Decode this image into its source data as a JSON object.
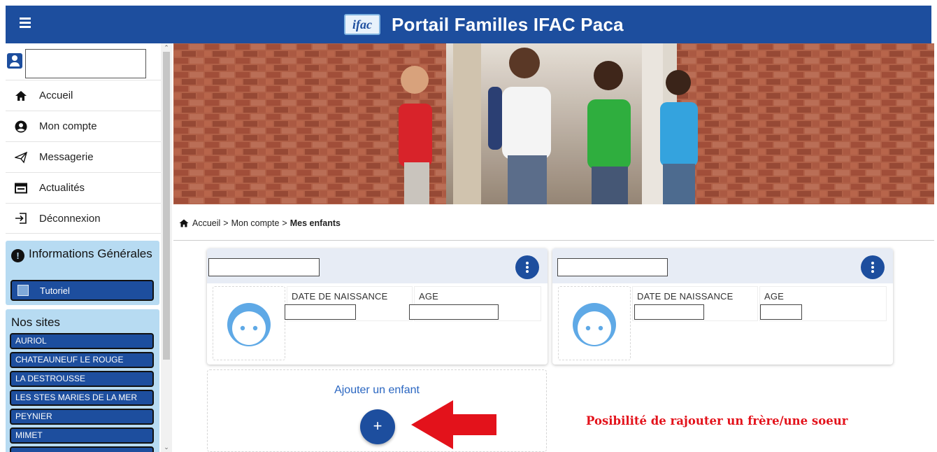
{
  "header": {
    "logo_text": "ifac",
    "title": "Portail Familles IFAC Paca",
    "bg_color": "#1d4e9e"
  },
  "sidebar": {
    "user_field_value": "",
    "nav": [
      {
        "label": "Accueil",
        "icon": "home-icon"
      },
      {
        "label": "Mon compte",
        "icon": "account-circle-icon"
      },
      {
        "label": "Messagerie",
        "icon": "paper-plane-icon"
      },
      {
        "label": "Actualités",
        "icon": "newspaper-icon"
      },
      {
        "label": "Déconnexion",
        "icon": "logout-icon"
      }
    ],
    "info_panel": {
      "title": "Informations Générales",
      "button": "Tutoriel"
    },
    "sites_panel": {
      "title": "Nos sites",
      "sites": [
        "AURIOL",
        "CHATEAUNEUF LE ROUGE",
        "LA DESTROUSSE",
        "LES STES MARIES DE LA MER",
        "PEYNIER",
        "MIMET",
        ""
      ]
    }
  },
  "breadcrumb": {
    "items": [
      "Accueil",
      "Mon compte"
    ],
    "separator": ">",
    "current": "Mes enfants"
  },
  "children": [
    {
      "name": "",
      "birth_label": "DATE DE NAISSANCE",
      "birth_value": "",
      "age_label": "AGE",
      "age_value": ""
    },
    {
      "name": "",
      "birth_label": "DATE DE NAISSANCE",
      "birth_value": "",
      "age_label": "AGE",
      "age_value": ""
    }
  ],
  "add_child": {
    "label": "Ajouter un enfant",
    "button_symbol": "+"
  },
  "annotation": {
    "text": "Posibilité de rajouter un frère/une soeur",
    "color": "#e3121b"
  }
}
